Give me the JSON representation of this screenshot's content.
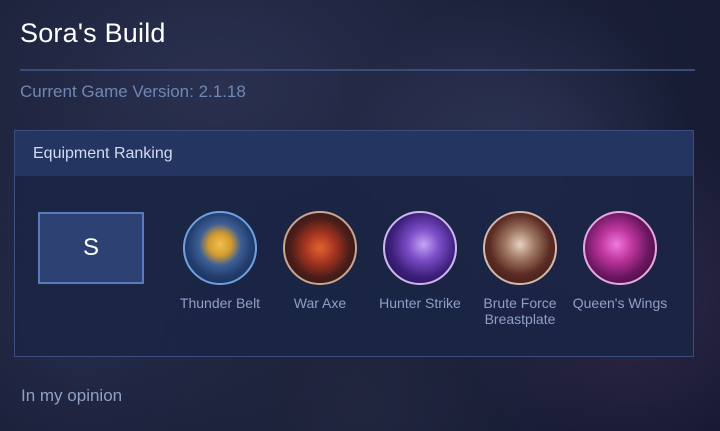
{
  "page": {
    "title": "Sora's Build",
    "version": "Current Game Version: 2.1.18",
    "footer": "In my opinion"
  },
  "equipment": {
    "header": "Equipment Ranking",
    "tier": "S",
    "items": [
      {
        "name": "Thunder Belt",
        "icon": "thunder-belt-icon"
      },
      {
        "name": "War Axe",
        "icon": "war-axe-icon"
      },
      {
        "name": "Hunter Strike",
        "icon": "hunter-strike-icon"
      },
      {
        "name": "Brute Force Breastplate",
        "icon": "brute-force-breastplate-icon"
      },
      {
        "name": "Queen's Wings",
        "icon": "queens-wings-icon"
      }
    ]
  },
  "colors": {
    "background": "#1b2038",
    "panel": "#1a2444",
    "panel_header": "#253561",
    "tier_box": "#2d4273",
    "accent_text": "#6f87b4"
  }
}
